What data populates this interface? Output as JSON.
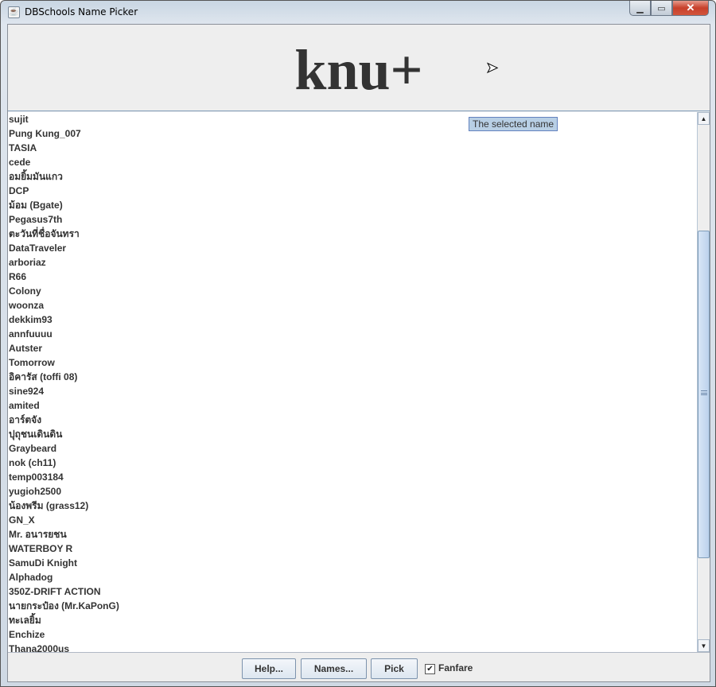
{
  "window": {
    "title": "DBSchools Name Picker"
  },
  "header": {
    "selected_name": "knu+"
  },
  "tooltip": "The selected name",
  "names": [
    "sujit",
    "Pung Kung_007",
    "TASIA",
    "cede",
    "อมยิ้มมันแกว",
    "DCP",
    "ม้อม (Bgate)",
    "Pegasus7th",
    "ตะวันที่ชื่อจันทรา",
    "DataTraveler",
    "arboriaz",
    "R66",
    "Colony",
    "woonza",
    "dekkim93",
    "annfuuuu",
    "Autster",
    "Tomorrow",
    "อิคารัส (toffi 08)",
    "sine924",
    "amited",
    "อาร์ตจัง",
    "ปุถุชนเดินดิน",
    "Graybeard",
    "nok (ch11)",
    "temp003184",
    "yugioh2500",
    "น้องพรีม (grass12)",
    "GN_X",
    "Mr. อนารยชน",
    "WATERBOY R",
    "SamuDi Knight",
    "Alphadog",
    "350Z-DRIFT ACTION",
    "นายกระป๋อง (Mr.KaPonG)",
    "ทะเลยิ้ม",
    "Enchize",
    "Thana2000us"
  ],
  "buttons": {
    "help": "Help...",
    "names": "Names...",
    "pick": "Pick"
  },
  "fanfare": {
    "label": "Fanfare",
    "checked": true
  }
}
